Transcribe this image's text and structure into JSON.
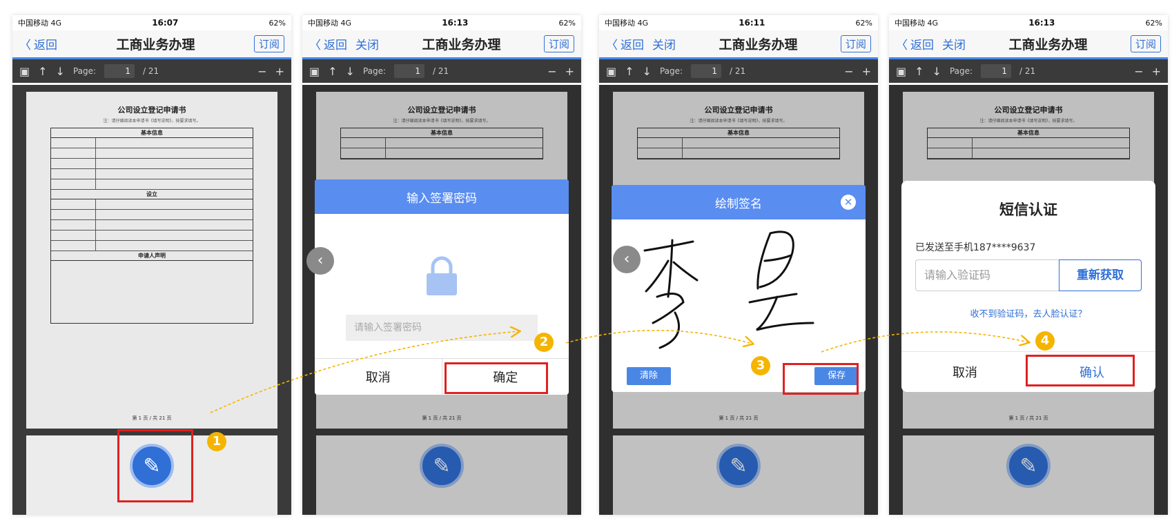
{
  "status": {
    "carrier": "中国移动 4G",
    "battery": "62%",
    "times": [
      "16:07",
      "16:13",
      "16:11",
      "16:13"
    ]
  },
  "nav": {
    "back_label": "返回",
    "close_label": "关闭",
    "title": "工商业务办理",
    "subscribe_label": "订阅"
  },
  "toolbar": {
    "page_label": "Page:",
    "page_current": "1",
    "page_total": "/ 21",
    "zoom_out": "−",
    "zoom_in": "+"
  },
  "document": {
    "title": "公司设立登记申请书",
    "note": "注：请仔细阅读本申请书《填写说明》，按要求填写。",
    "section_basic": "基本信息",
    "section_setup": "设立",
    "section_declare": "申请人声明",
    "footer": "第 1 页 / 共 21 页"
  },
  "password_dialog": {
    "title": "输入签署密码",
    "placeholder": "请输入签署密码",
    "cancel": "取消",
    "confirm": "确定"
  },
  "signature_dialog": {
    "title": "绘制签名",
    "clear": "清除",
    "save": "保存"
  },
  "sms_dialog": {
    "title": "短信认证",
    "sent_to": "已发送至手机187****9637",
    "placeholder": "请输入验证码",
    "resend": "重新获取",
    "face_auth": "收不到验证码，去人脸认证？",
    "cancel": "取消",
    "confirm": "确认"
  },
  "steps": [
    "1",
    "2",
    "3",
    "4"
  ],
  "colors": {
    "accent": "#4a87e5",
    "highlight": "#e02020",
    "step": "#f5b400"
  }
}
